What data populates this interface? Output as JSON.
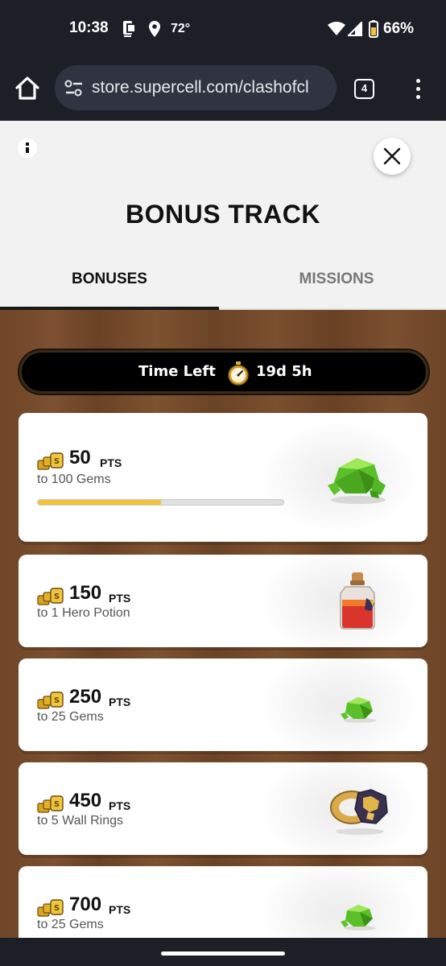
{
  "status_bar": {
    "time": "10:38",
    "temperature": "72°",
    "battery": "66%",
    "icons": [
      "screenshot-icon",
      "location-icon",
      "wifi-icon",
      "signal-icon",
      "battery-icon"
    ]
  },
  "browser": {
    "url": "store.supercell.com/clashofcl",
    "tab_count": "4"
  },
  "header": {
    "title": "BONUS TRACK",
    "tabs": [
      {
        "label": "BONUSES",
        "active": true
      },
      {
        "label": "MISSIONS",
        "active": false
      }
    ]
  },
  "timer": {
    "label": "Time Left",
    "value": "19d 5h"
  },
  "pts_unit": "PTS",
  "cards": [
    {
      "points": "50",
      "reward": "to 100 Gems",
      "icon": "gem-pile-icon",
      "progress": 0.5
    },
    {
      "points": "150",
      "reward": "to 1 Hero Potion",
      "icon": "hero-potion-icon"
    },
    {
      "points": "250",
      "reward": "to 25 Gems",
      "icon": "gem-icon"
    },
    {
      "points": "450",
      "reward": "to 5 Wall Rings",
      "icon": "wall-ring-icon"
    },
    {
      "points": "700",
      "reward": "to 25 Gems",
      "icon": "gem-icon"
    }
  ],
  "colors": {
    "progress": "#f2c23d",
    "wood": "#734a2b",
    "system_bar": "#1c1f26"
  }
}
